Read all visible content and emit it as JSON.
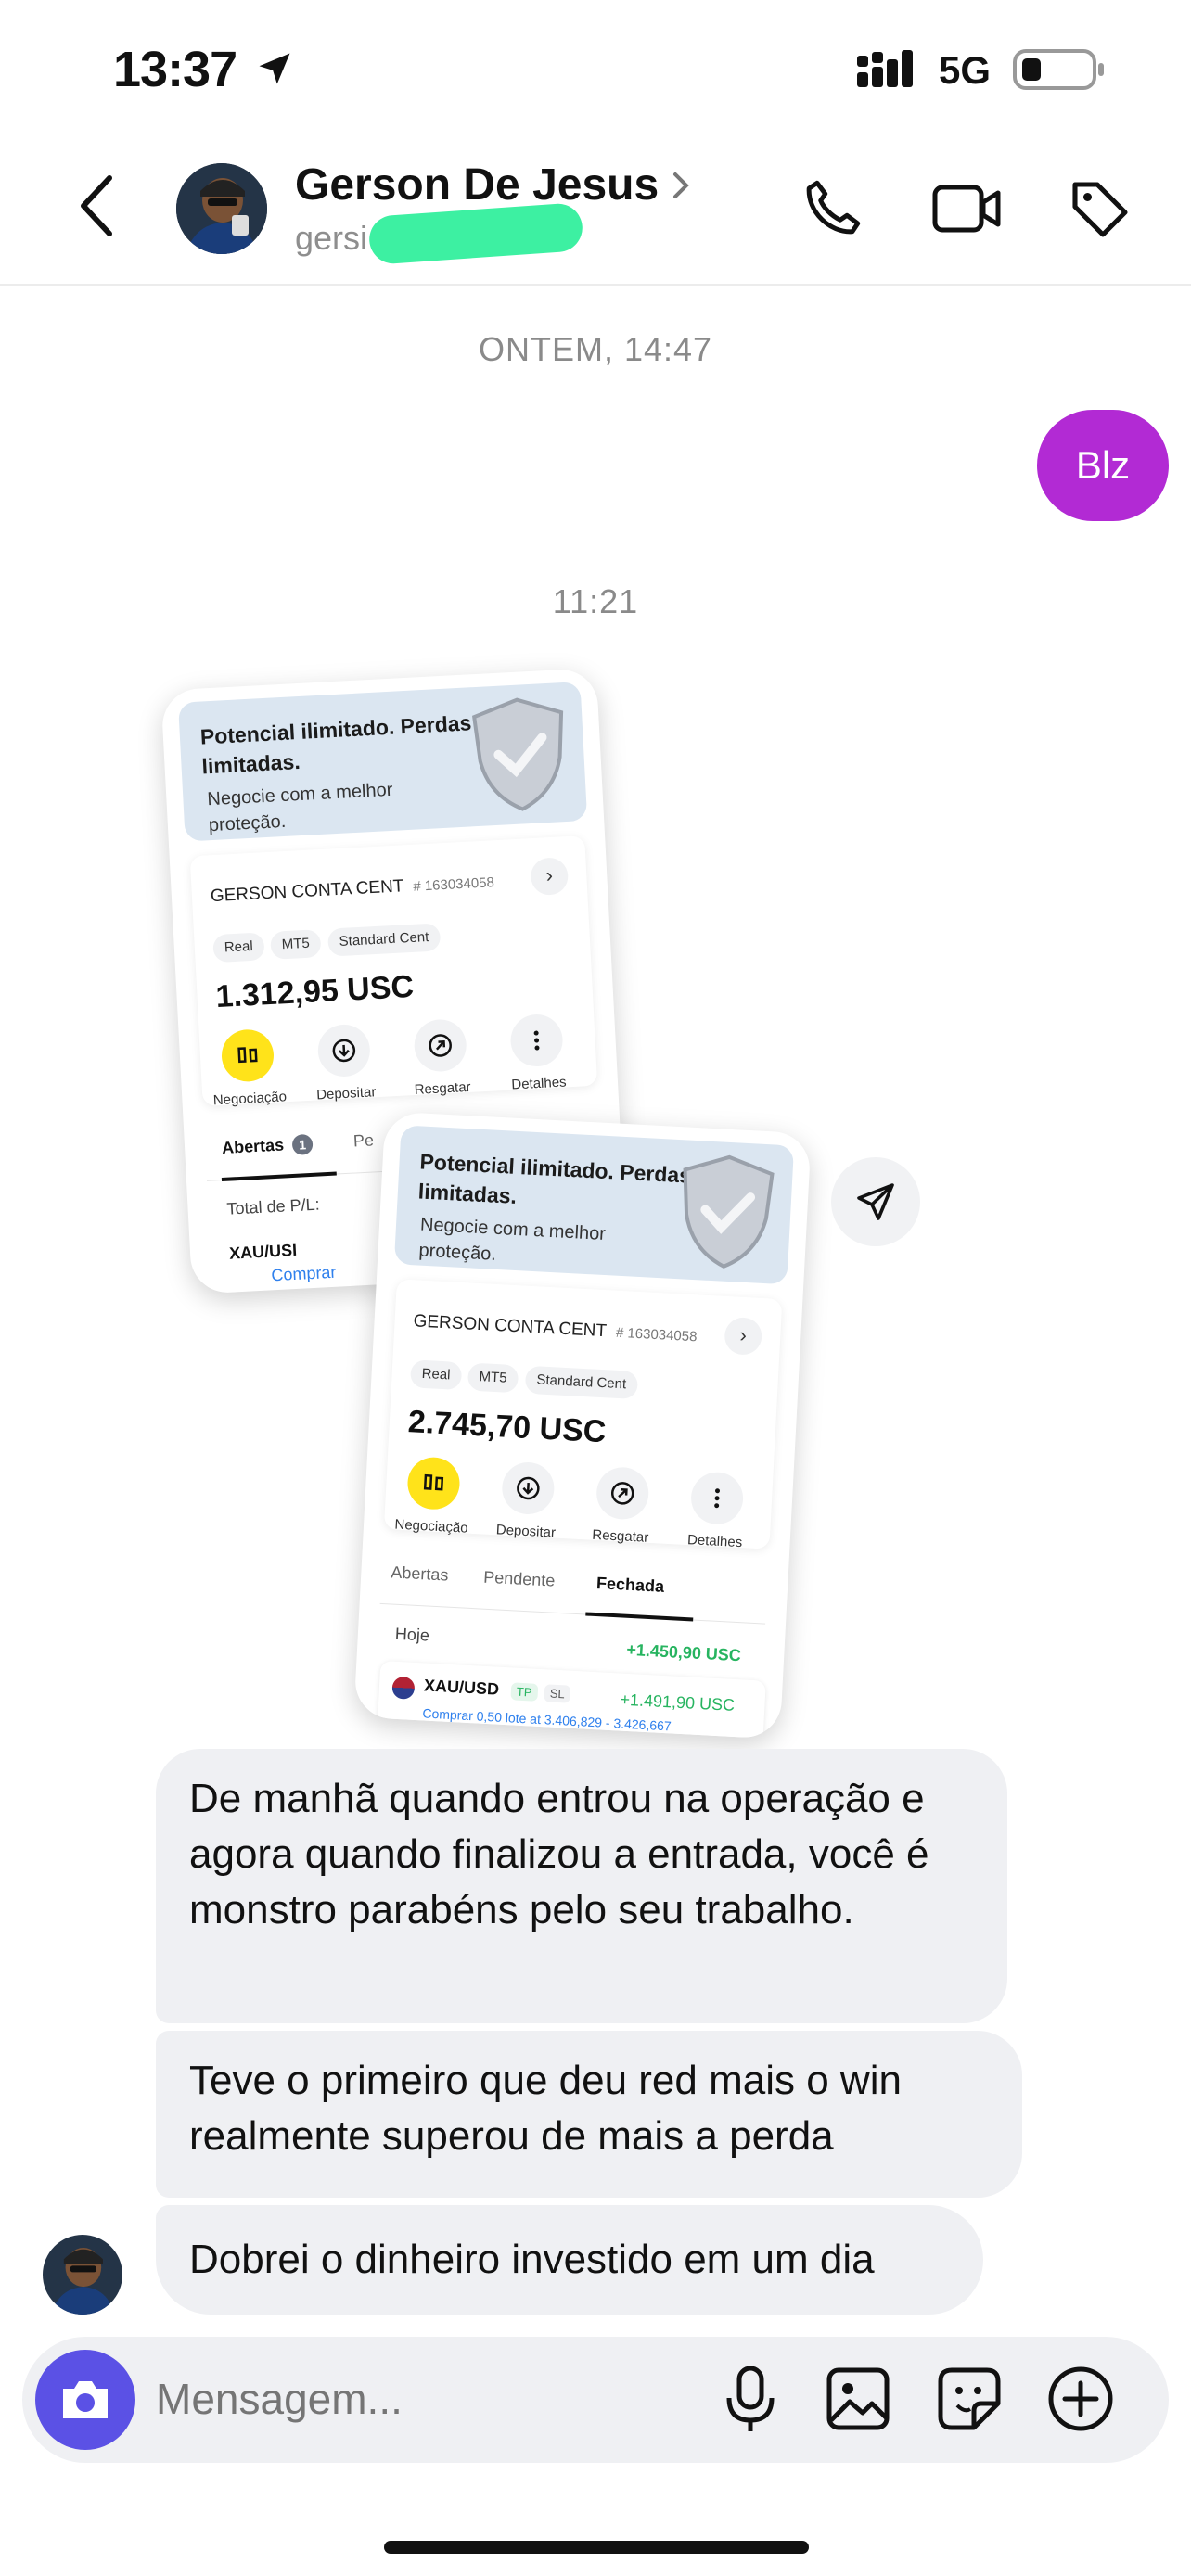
{
  "status_bar": {
    "time": "13:37",
    "network": "5G"
  },
  "header": {
    "contact_name": "Gerson De Jesus",
    "username_partial": "gersi",
    "icons": [
      "back-arrow-icon",
      "phone-icon",
      "video-camera-icon",
      "tag-icon"
    ]
  },
  "conversation": {
    "timestamp_1": "ONTEM, 14:47",
    "sent_message": "Blz",
    "timestamp_2": "11:21",
    "card_1": {
      "promo_title": "Potencial ilimitado. Perdas limitadas.",
      "promo_sub": "Negocie com a melhor proteção.",
      "account_name": "GERSON CONTA CENT",
      "account_number": "# 163034058",
      "tags": [
        "Real",
        "MT5",
        "Standard Cent"
      ],
      "balance": "1.312,95 USC",
      "actions": [
        "Negociação",
        "Depositar",
        "Resgatar",
        "Detalhes"
      ],
      "tab_open": "Abertas",
      "tab_open_count": "1",
      "tab_pending_partial": "Pe",
      "total_pl_label": "Total de P/L:",
      "symbol_partial": "XAU/USI",
      "buy_partial": "Comprar"
    },
    "card_2": {
      "promo_title": "Potencial ilimitado. Perdas limitadas.",
      "promo_sub": "Negocie com a melhor proteção.",
      "account_name": "GERSON CONTA CENT",
      "account_number": "# 163034058",
      "tags": [
        "Real",
        "MT5",
        "Standard Cent"
      ],
      "balance": "2.745,70 USC",
      "actions": [
        "Negociação",
        "Depositar",
        "Resgatar",
        "Detalhes"
      ],
      "tabs": [
        "Abertas",
        "Pendente",
        "Fechada"
      ],
      "today_label": "Hoje",
      "today_total": "+1.450,90 USC",
      "symbol": "XAU/USD",
      "tp": "TP",
      "sl": "SL",
      "symbol_pl": "+1.491,90 USC",
      "detail_partial": "Comprar 0,50 lote at 3.406,829 - 3.426,667"
    },
    "received_messages": [
      "De manhã quando entrou na operação e agora quando finalizou a entrada, você é monstro parabéns pelo seu trabalho.",
      "Teve o primeiro que deu red mais o win realmente superou de mais a perda",
      "Dobrei o dinheiro investido em um dia"
    ]
  },
  "composer": {
    "placeholder": "Mensagem...",
    "icons": [
      "camera-icon",
      "microphone-icon",
      "image-icon",
      "sticker-icon",
      "plus-icon"
    ]
  }
}
